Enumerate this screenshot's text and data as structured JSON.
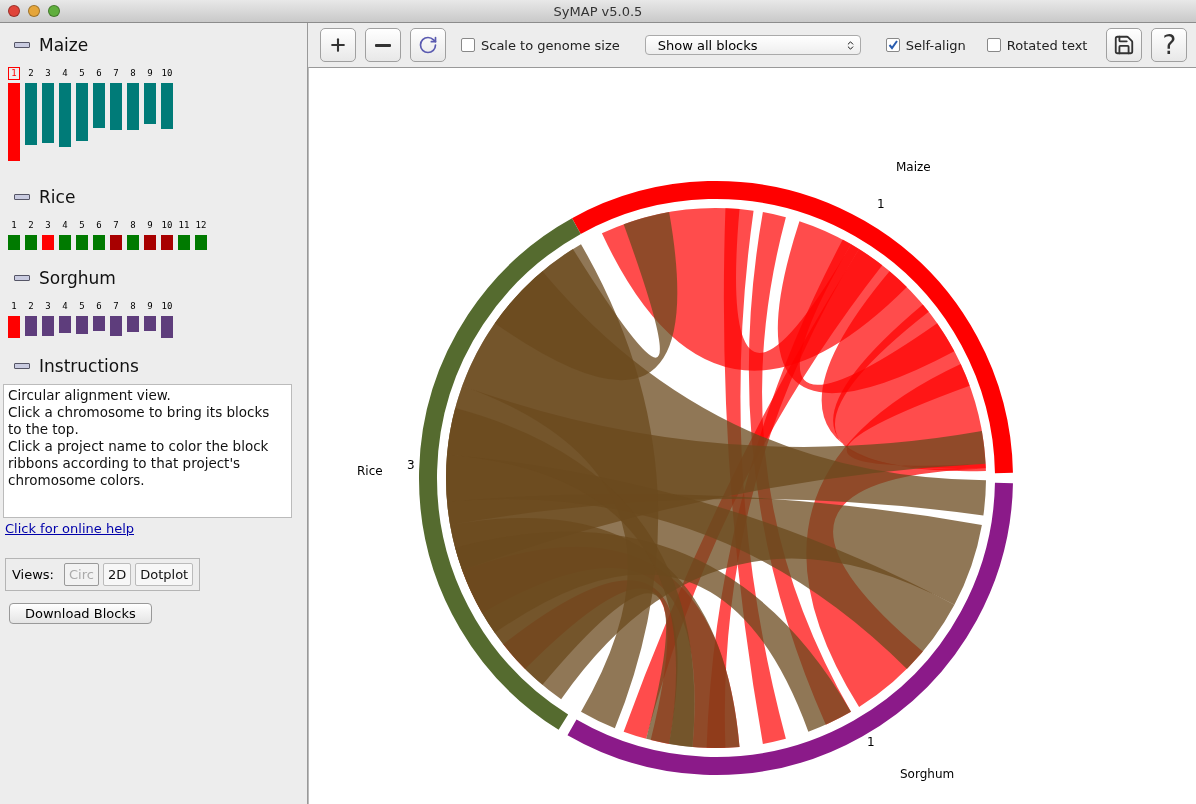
{
  "window": {
    "title": "SyMAP v5.0.5"
  },
  "projects": [
    {
      "name": "Maize",
      "chromosomes": [
        {
          "label": "1",
          "color": "#ff0000",
          "selected": true
        },
        {
          "label": "2",
          "color": "#007b78",
          "selected": false
        },
        {
          "label": "3",
          "color": "#007b78",
          "selected": false
        },
        {
          "label": "4",
          "color": "#007b78",
          "selected": false
        },
        {
          "label": "5",
          "color": "#007b78",
          "selected": false
        },
        {
          "label": "6",
          "color": "#007b78",
          "selected": false
        },
        {
          "label": "7",
          "color": "#007b78",
          "selected": false
        },
        {
          "label": "8",
          "color": "#007b78",
          "selected": false
        },
        {
          "label": "9",
          "color": "#007b78",
          "selected": false
        },
        {
          "label": "10",
          "color": "#007b78",
          "selected": false
        }
      ]
    },
    {
      "name": "Rice",
      "chromosomes": [
        {
          "label": "1",
          "color": "#007a00",
          "selected": false
        },
        {
          "label": "2",
          "color": "#007a00",
          "selected": false
        },
        {
          "label": "3",
          "color": "#ff0000",
          "selected": false
        },
        {
          "label": "4",
          "color": "#007a00",
          "selected": false
        },
        {
          "label": "5",
          "color": "#007a00",
          "selected": false
        },
        {
          "label": "6",
          "color": "#007a00",
          "selected": false
        },
        {
          "label": "7",
          "color": "#a80000",
          "selected": false
        },
        {
          "label": "8",
          "color": "#007a00",
          "selected": false
        },
        {
          "label": "9",
          "color": "#a80000",
          "selected": false
        },
        {
          "label": "10",
          "color": "#a80000",
          "selected": false
        },
        {
          "label": "11",
          "color": "#007a00",
          "selected": false
        },
        {
          "label": "12",
          "color": "#007a00",
          "selected": false
        }
      ]
    },
    {
      "name": "Sorghum",
      "chromosomes": [
        {
          "label": "1",
          "color": "#ff0000",
          "selected": false
        },
        {
          "label": "2",
          "color": "#5e3d7c",
          "selected": false
        },
        {
          "label": "3",
          "color": "#5e3d7c",
          "selected": false
        },
        {
          "label": "4",
          "color": "#5e3d7c",
          "selected": false
        },
        {
          "label": "5",
          "color": "#5e3d7c",
          "selected": false
        },
        {
          "label": "6",
          "color": "#5e3d7c",
          "selected": false
        },
        {
          "label": "7",
          "color": "#5e3d7c",
          "selected": false
        },
        {
          "label": "8",
          "color": "#5e3d7c",
          "selected": false
        },
        {
          "label": "9",
          "color": "#5e3d7c",
          "selected": false
        },
        {
          "label": "10",
          "color": "#5e3d7c",
          "selected": false
        }
      ]
    }
  ],
  "instructions": {
    "title": "Instructions",
    "paragraphs": [
      "Circular alignment view.",
      "Click a chromosome to bring its blocks to the top.",
      "Click a project name to color the block ribbons according to that project's chromosome colors."
    ],
    "help_link": "Click for online help"
  },
  "views": {
    "label": "Views:",
    "buttons": [
      {
        "label": "Circ",
        "selected": true
      },
      {
        "label": "2D",
        "selected": false
      },
      {
        "label": "Dotplot",
        "selected": false
      }
    ]
  },
  "download_button": "Download Blocks",
  "toolbar": {
    "scale_to_genome": {
      "label": "Scale to genome size",
      "checked": false
    },
    "block_filter": "Show all blocks",
    "self_align": {
      "label": "Self-align",
      "checked": true
    },
    "rotated_text": {
      "label": "Rotated text",
      "checked": false
    },
    "help_button": "?"
  },
  "circle": {
    "projects": [
      {
        "name": "Maize",
        "chromosome": "1",
        "color": "#ff0000"
      },
      {
        "name": "Rice",
        "chromosome": "3",
        "color": "#556b2f"
      },
      {
        "name": "Sorghum",
        "chromosome": "1",
        "color": "#8b1a89"
      }
    ]
  }
}
